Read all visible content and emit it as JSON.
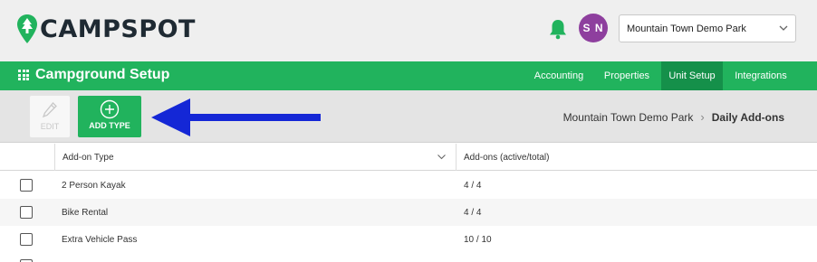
{
  "header": {
    "brand": "CAMPSPOT",
    "user_initials": "S N",
    "park_selector_value": "Mountain Town Demo Park"
  },
  "nav": {
    "title": "Campground Setup",
    "tabs": [
      {
        "label": "Accounting"
      },
      {
        "label": "Properties"
      },
      {
        "label": "Unit Setup",
        "active": true
      },
      {
        "label": "Integrations"
      }
    ]
  },
  "toolbar": {
    "edit_label": "EDIT",
    "add_label": "ADD TYPE"
  },
  "breadcrumb": {
    "parent": "Mountain Town Demo Park",
    "current": "Daily Add-ons"
  },
  "table": {
    "columns": [
      "Add-on Type",
      "Add-ons (active/total)"
    ],
    "rows": [
      {
        "type": "2 Person Kayak",
        "count": "4 / 4"
      },
      {
        "type": "Bike Rental",
        "count": "4 / 4"
      },
      {
        "type": "Extra Vehicle Pass",
        "count": "10 / 10"
      }
    ]
  },
  "colors": {
    "brand_green": "#21b35d",
    "active_tab": "#15904a",
    "avatar": "#8e3f9e",
    "annotation_arrow": "#1427d6"
  }
}
